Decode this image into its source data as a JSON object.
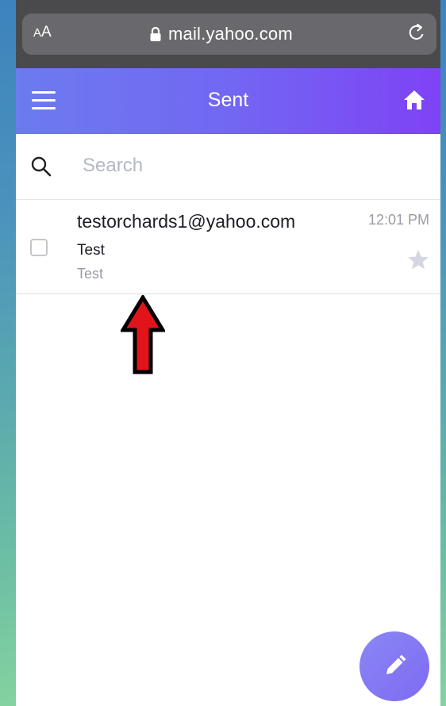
{
  "browser": {
    "aa_small": "A",
    "aa_large": "A",
    "url": "mail.yahoo.com"
  },
  "header": {
    "title": "Sent"
  },
  "search": {
    "placeholder": "Search",
    "value": ""
  },
  "messages": [
    {
      "sender": "testorchards1@yahoo.com",
      "subject": "Test",
      "snippet": "Test",
      "time": "12:01 PM",
      "starred": false,
      "checked": false
    }
  ],
  "icons": {
    "menu": "menu-icon",
    "home": "home-icon",
    "search": "search-icon",
    "lock": "lock-icon",
    "reload": "reload-icon",
    "star": "star-icon",
    "compose": "pencil-icon",
    "annotation": "arrow-up-icon"
  },
  "colors": {
    "header_start": "#6c7bf0",
    "header_end": "#7f42f5",
    "compose": "#8b86f5",
    "annotation_arrow": "#e0141a",
    "star_inactive": "#d6d6e0"
  }
}
